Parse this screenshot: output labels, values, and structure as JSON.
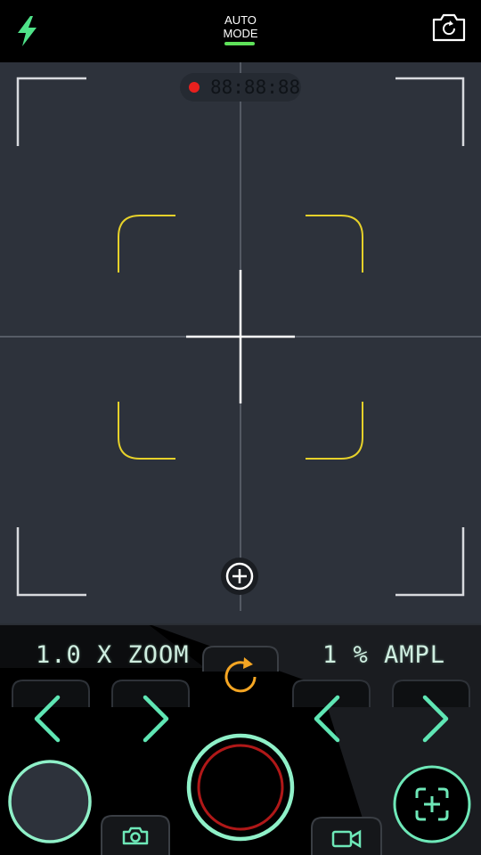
{
  "topbar": {
    "mode_line1": "AUTO",
    "mode_line2": "MODE",
    "flash_icon": "lightning-bolt-icon",
    "switch_camera_icon": "camera-switch-icon"
  },
  "viewfinder": {
    "timer": "88:88:88",
    "recording_indicator_color": "#e8201e",
    "focus_bracket_color": "#e6d12a"
  },
  "controls": {
    "zoom_label": "1.0 X ZOOM",
    "ampl_label": "1 % AMPL",
    "accent_color": "#5fe6b4",
    "refresh_color": "#f5a623"
  }
}
